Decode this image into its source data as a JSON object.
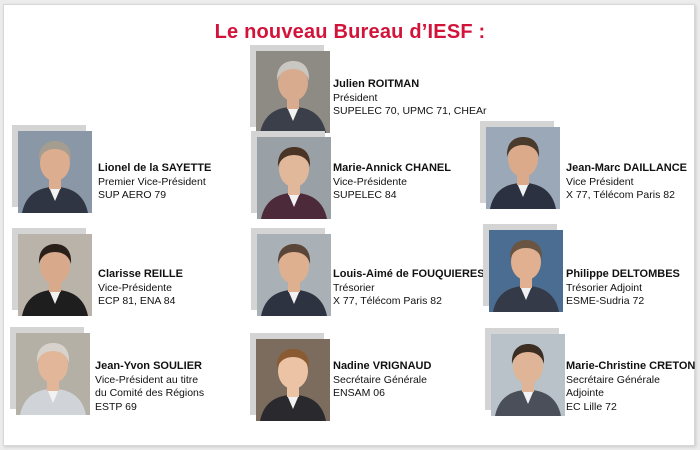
{
  "title": "Le nouveau Bureau d’IESF :",
  "colors": {
    "title": "#d2143a",
    "text": "#111111",
    "photo_shadow": "#d4d4d4"
  },
  "members": [
    {
      "id": "roitman",
      "name": "Julien ROITMAN",
      "role": "Président",
      "details": [
        "SUPELEC 70, UPMC 71, CHEAr"
      ]
    },
    {
      "id": "sayette",
      "name": "Lionel de la SAYETTE",
      "role": "Premier Vice-Président",
      "details": [
        "SUP AERO 79"
      ]
    },
    {
      "id": "chanel",
      "name": "Marie-Annick CHANEL",
      "role": "Vice-Présidente",
      "details": [
        "SUPELEC 84"
      ]
    },
    {
      "id": "daillance",
      "name": "Jean-Marc DAILLANCE",
      "role": "Vice Président",
      "details": [
        "X 77, Télécom Paris 82"
      ]
    },
    {
      "id": "reille",
      "name": "Clarisse REILLE",
      "role": "Vice-Présidente",
      "details": [
        "ECP 81, ENA  84"
      ]
    },
    {
      "id": "fouquieres",
      "name": "Louis-Aimé de FOUQUIERES",
      "role": "Trésorier",
      "details": [
        "X 77, Télécom Paris 82"
      ]
    },
    {
      "id": "deltombes",
      "name": "Philippe DELTOMBES",
      "role": "Trésorier Adjoint",
      "details": [
        "ESME-Sudria 72"
      ]
    },
    {
      "id": "soulier",
      "name": "Jean-Yvon SOULIER",
      "role": "Vice-Président au titre",
      "details": [
        "du Comité des Régions",
        "ESTP 69"
      ]
    },
    {
      "id": "vrignaud",
      "name": "Nadine VRIGNAUD",
      "role": "Secrétaire Générale",
      "details": [
        "ENSAM 06"
      ]
    },
    {
      "id": "creton",
      "name": "Marie-Christine CRETON",
      "role": "Secrétaire Générale",
      "details": [
        "Adjointe",
        "EC Lille 72"
      ]
    }
  ]
}
